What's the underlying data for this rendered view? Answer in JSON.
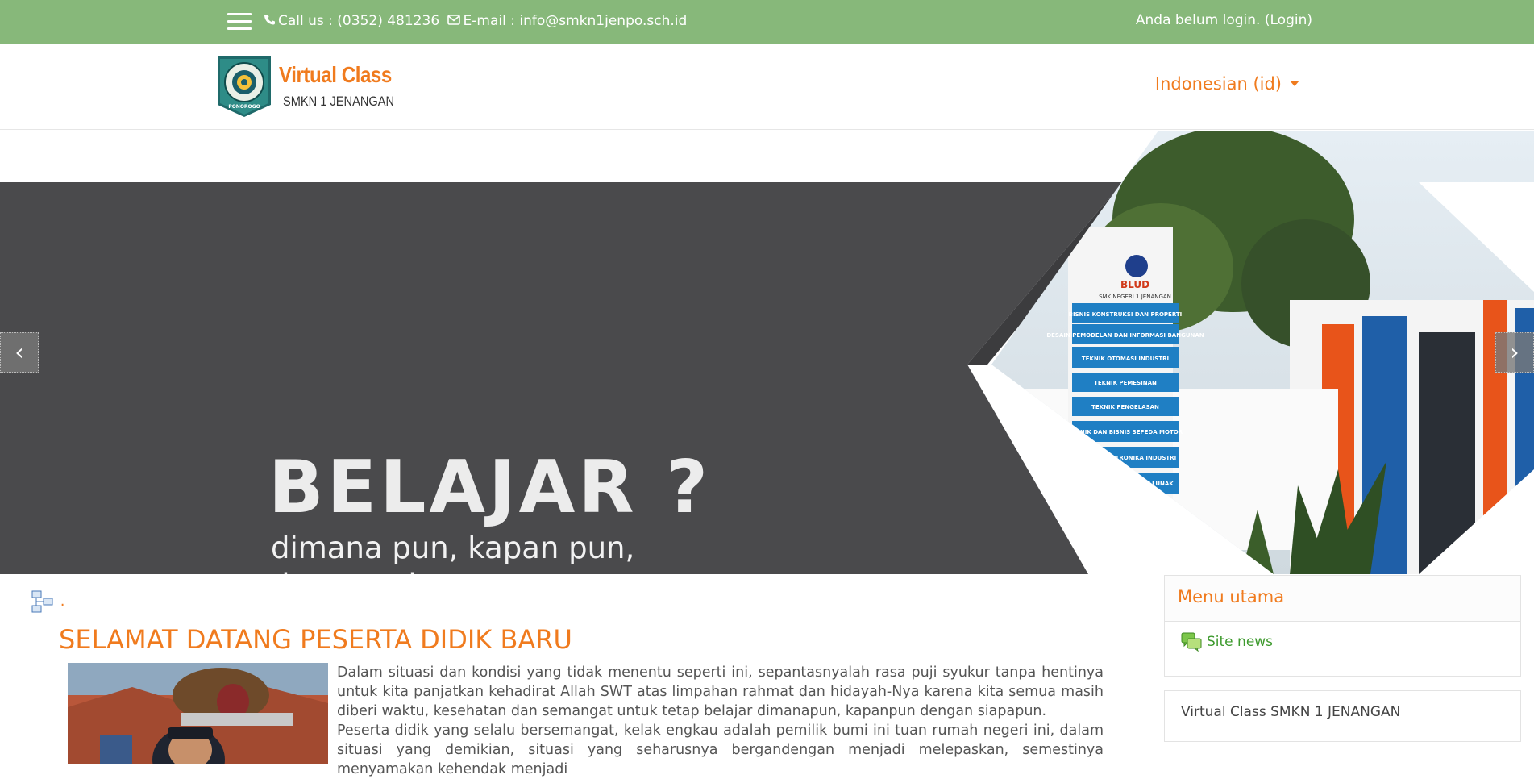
{
  "topbar": {
    "contact_phone": "Call us : (0352) 481236",
    "contact_email": "E-mail : info@smkn1jenpo.sch.id",
    "login_status": "Anda belum login. ",
    "login_link": "(Login)"
  },
  "header": {
    "logo_title": "Virtual Class",
    "logo_subtitle": "SMKN 1 JENANGAN",
    "language": "Indonesian (id)"
  },
  "slider": {
    "heading": "BELAJAR ?",
    "line1": "dimana pun, kapan pun,",
    "line2": "dengan siapa pun.",
    "prev_label": "‹",
    "next_label": "›",
    "sign_heading": "BLUD",
    "sign_sub": "SMK NEGERI 1 JENANGAN",
    "programs": [
      "BISNIS KONSTRUKSI DAN PROPERTI",
      "DESAIN PEMODELAN DAN INFORMASI BANGUNAN",
      "TEKNIK OTOMASI INDUSTRI",
      "TEKNIK PEMESINAN",
      "TEKNIK PENGELASAN",
      "TEKNIK DAN BISNIS SEPEDA MOTOR",
      "TEKNIK ELEKTRONIKA INDUSTRI",
      "REKAYASA PERANGKAT LUNAK"
    ]
  },
  "main": {
    "breadcrumb": ".",
    "title": "SELAMAT DATANG PESERTA DIDIK BARU",
    "paragraph1": "Dalam situasi dan kondisi yang tidak menentu seperti ini, sepantasnyalah rasa puji syukur tanpa hentinya untuk kita panjatkan kehadirat Allah SWT atas limpahan rahmat dan hidayah-Nya karena kita semua masih diberi waktu, kesehatan dan semangat untuk tetap belajar dimanapun, kapanpun dengan siapapun.",
    "paragraph2": "Peserta didik yang selalu bersemangat, kelak engkau adalah pemilik bumi ini tuan rumah negeri ini, dalam situasi yang demikian, situasi yang seharusnya bergandengan menjadi melepaskan, semestinya menyamakan kehendak menjadi"
  },
  "sidebar": {
    "menu_title": "Menu utama",
    "menu_item": "Site news",
    "block_text": "Virtual Class SMKN 1 JENANGAN"
  },
  "colors": {
    "topbar_bg": "#87b87a",
    "accent_orange": "#f07b1e",
    "link_green": "#3e9a2e",
    "slider_bg": "#4a4a4c"
  }
}
